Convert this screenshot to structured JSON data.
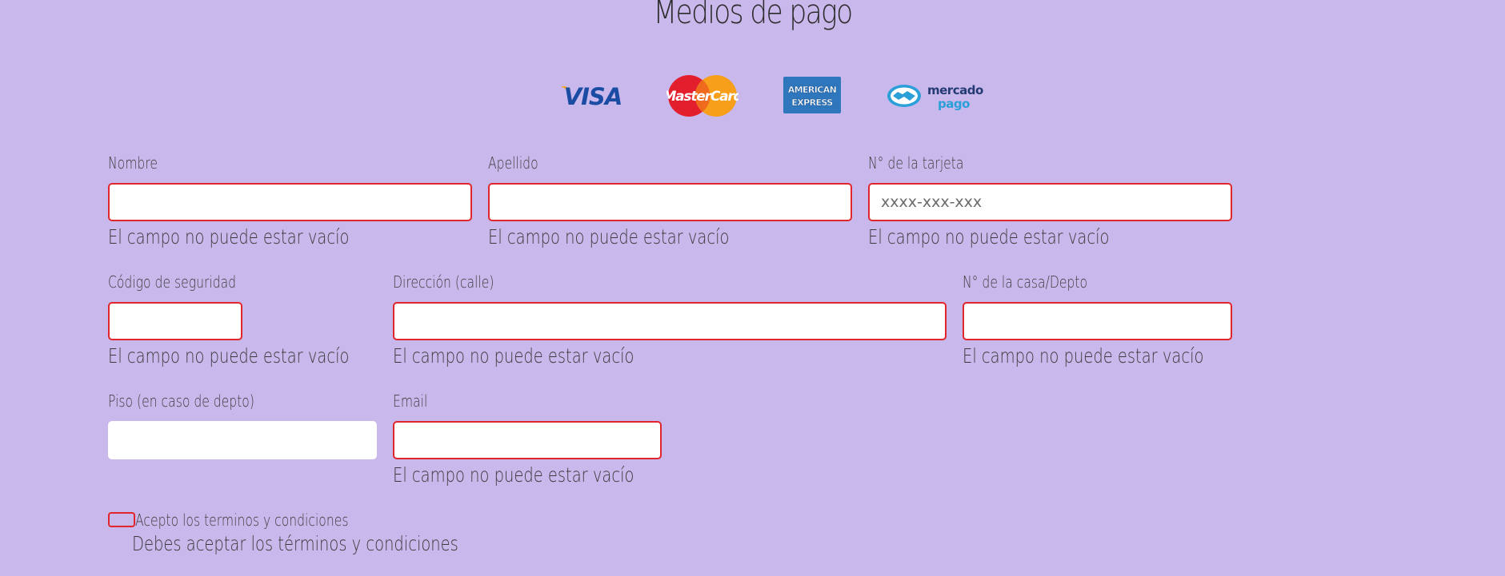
{
  "page": {
    "title": "Medios de pago"
  },
  "logos": {
    "visa": "VISA",
    "mastercard": "MasterCard",
    "amex_line1": "AMERICAN",
    "amex_line2": "EXPRESS",
    "mercado_line1": "mercado",
    "mercado_line2": "pago"
  },
  "form": {
    "nombre": {
      "label": "Nombre",
      "value": "",
      "error": "El campo no puede estar vacío"
    },
    "apellido": {
      "label": "Apellido",
      "value": "",
      "error": "El campo no puede estar vacío"
    },
    "tarjeta": {
      "label": "N° de la tarjeta",
      "placeholder": "xxxx-xxx-xxx",
      "value": "",
      "error": "El campo no puede estar vacío"
    },
    "codigo": {
      "label": "Código de seguridad",
      "value": "",
      "error": "El campo no puede estar vacío"
    },
    "direccion": {
      "label": "Dirección (calle)",
      "value": "",
      "error": "El campo no puede estar vacío"
    },
    "casa": {
      "label": "N° de la casa/Depto",
      "value": "",
      "error": "El campo no puede estar vacío"
    },
    "piso": {
      "label": "Piso (en caso de depto)",
      "value": ""
    },
    "email": {
      "label": "Email",
      "value": "",
      "error": "El campo no puede estar vacío"
    },
    "terms": {
      "label": "Acepto los terminos y condiciones",
      "checked": false,
      "error": "Debes aceptar los términos y condiciones"
    }
  },
  "colors": {
    "background": "#c9b8ec",
    "error_border": "#e0262a",
    "input_bg": "#ffffff"
  }
}
